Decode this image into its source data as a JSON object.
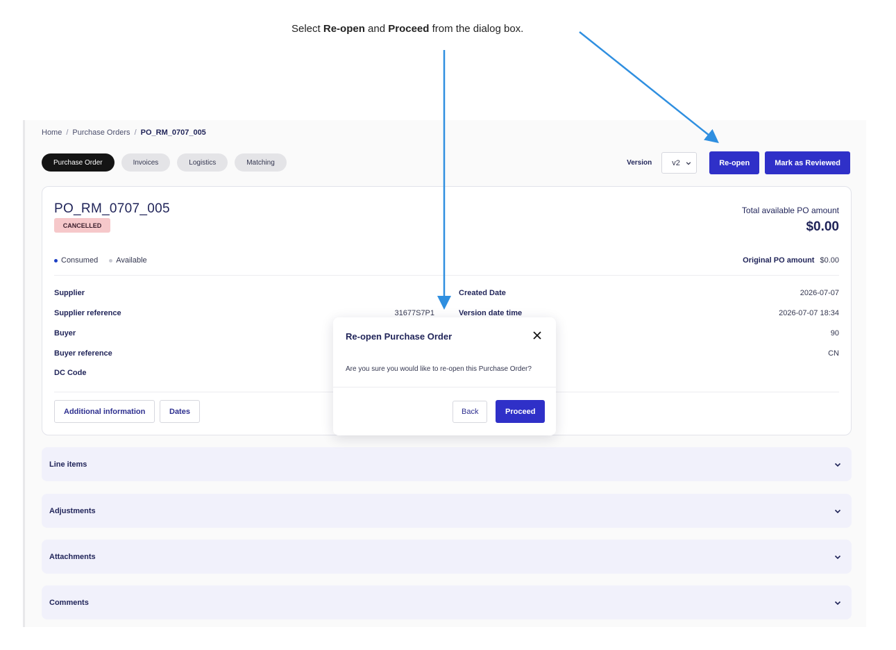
{
  "instruction": {
    "prefix": "Select ",
    "bold1": "Re-open",
    "middle": " and ",
    "bold2": "Proceed",
    "suffix": " from the dialog box."
  },
  "breadcrumb": {
    "home": "Home",
    "sep": "/",
    "purchase_orders": "Purchase Orders",
    "current": "PO_RM_0707_005"
  },
  "tabs": [
    {
      "label": "Purchase Order",
      "active": true
    },
    {
      "label": "Invoices"
    },
    {
      "label": "Logistics"
    },
    {
      "label": "Matching"
    }
  ],
  "toolbar": {
    "version_label": "Version",
    "version_value": "v2",
    "reopen_label": "Re-open",
    "mark_reviewed_label": "Mark as Reviewed"
  },
  "po": {
    "title": "PO_RM_0707_005",
    "status": "CANCELLED",
    "total_label": "Total available PO amount",
    "total_value": "$0.00",
    "legend_consumed": "Consumed",
    "legend_available": "Available",
    "original_label": "Original PO amount",
    "original_value": "$0.00",
    "fields_left": [
      {
        "label": "Supplier",
        "value": ""
      },
      {
        "label": "Supplier reference",
        "value": "31677S7P1"
      },
      {
        "label": "Buyer",
        "value": ""
      },
      {
        "label": "Buyer reference",
        "value": ""
      },
      {
        "label": "DC Code",
        "value": ""
      }
    ],
    "fields_right": [
      {
        "label": "Created Date",
        "value": "2026-07-07"
      },
      {
        "label": "Version date time",
        "value": "2026-07-07 18:34"
      },
      {
        "label": "",
        "value": "90"
      },
      {
        "label": "",
        "value": "CN"
      }
    ],
    "additional_info_label": "Additional information",
    "dates_label": "Dates"
  },
  "accordions": [
    {
      "label": "Line items"
    },
    {
      "label": "Adjustments"
    },
    {
      "label": "Attachments"
    },
    {
      "label": "Comments"
    }
  ],
  "modal": {
    "title": "Re-open Purchase Order",
    "body": "Are you sure you would like to re-open this Purchase Order?",
    "back_label": "Back",
    "proceed_label": "Proceed"
  },
  "colors": {
    "primary": "#2f30c8",
    "accent_arrow": "#2f8fe0",
    "badge_bg": "#f6c8ca",
    "consumed_dot": "#1c3fc4",
    "available_dot": "#c8c9d2"
  }
}
